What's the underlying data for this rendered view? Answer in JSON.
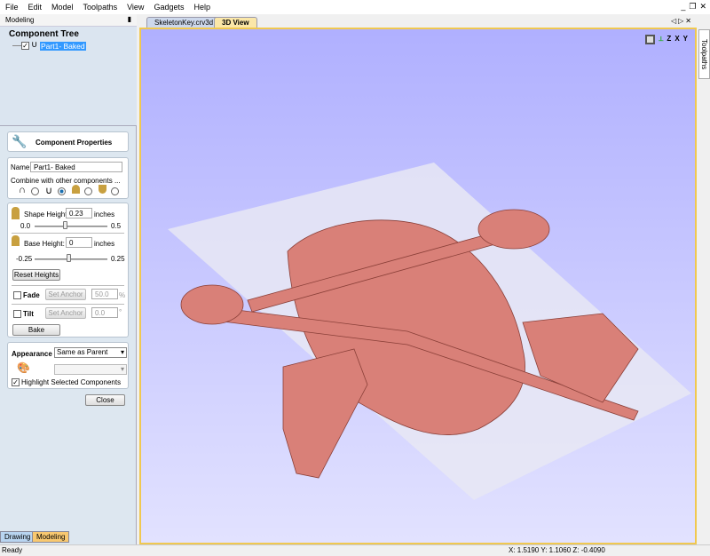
{
  "menu": [
    "File",
    "Edit",
    "Model",
    "Toolpaths",
    "View",
    "Gadgets",
    "Help"
  ],
  "window_controls": {
    "minimize": "_",
    "restore": "❐",
    "close": "✕"
  },
  "panel": {
    "title": "Modeling",
    "pin": "📌"
  },
  "tree": {
    "title": "Component Tree",
    "item": "Part1- Baked",
    "checked": true
  },
  "props": {
    "title": "Component Properties",
    "name_label": "Name",
    "name_value": "Part1- Baked",
    "combine_label": "Combine with other components ...",
    "combine_selected": 1,
    "shape_height_label": "Shape Height:",
    "shape_height_value": "0.23",
    "shape_unit": "inches",
    "shape_min": "0.0",
    "shape_max": "0.5",
    "base_height_label": "Base Height:",
    "base_height_value": "0",
    "base_unit": "inches",
    "base_min": "-0.25",
    "base_max": "0.25",
    "reset": "Reset Heights",
    "fade_label": "Fade",
    "fade_anchor": "Set Anchor",
    "fade_value": "50.0",
    "fade_unit": "%",
    "tilt_label": "Tilt",
    "tilt_anchor": "Set Anchor",
    "tilt_value": "0.0",
    "tilt_unit": "°",
    "bake": "Bake",
    "appearance_label": "Appearance",
    "appearance_value": "Same as Parent",
    "highlight_label": "Highlight Selected Components",
    "highlight_checked": true,
    "close": "Close"
  },
  "doc_tabs": [
    {
      "label": "SkeletonKey.crv3d",
      "active": false
    },
    {
      "label": "3D View",
      "active": true
    }
  ],
  "view_controls": [
    "◁",
    "▷",
    "✕"
  ],
  "view_icons": [
    "zoom-fit-icon",
    "iso-view-icon",
    "top-view-icon",
    "front-view-icon",
    "side-view-icon"
  ],
  "view_icon_labels": [
    "",
    "",
    "Z",
    "X",
    "Y"
  ],
  "right_tab": "Toolpaths",
  "bottom_tabs": [
    "Drawing",
    "Modeling"
  ],
  "status": {
    "text": "Ready",
    "coords": "X: 1.5190 Y: 1.1060 Z: -0.4090"
  },
  "colors": {
    "model": "#d98078",
    "background_top": "#b0b0ff",
    "accent": "#f0c850"
  }
}
